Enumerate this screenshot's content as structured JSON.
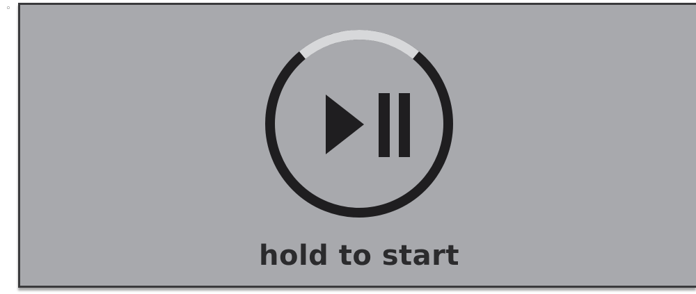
{
  "bullet": {
    "glyph": "◦"
  },
  "control": {
    "icon": "play-pause-icon",
    "hold_progress": 0.22,
    "ring_color": "#1f1e20",
    "progress_color": "#d7d8da",
    "icon_color": "#1f1e20"
  },
  "panel": {
    "background": "#a8a9ad",
    "label": "hold to start"
  }
}
